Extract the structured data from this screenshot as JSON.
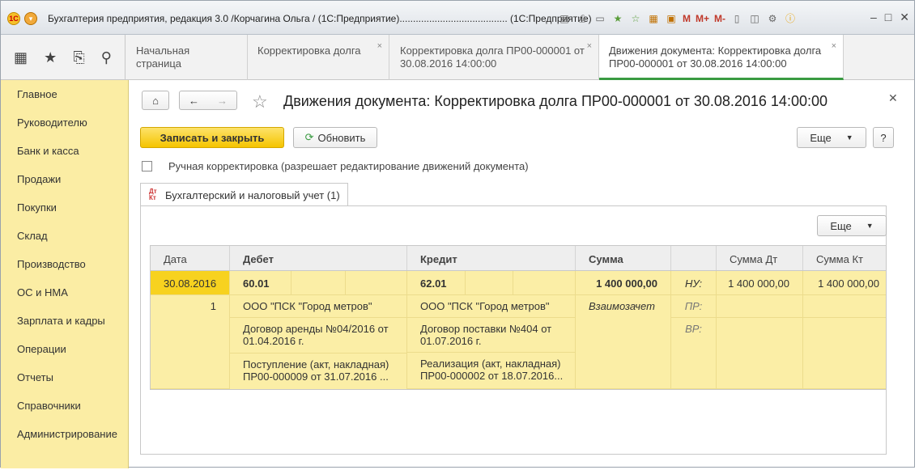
{
  "app": {
    "title": "Бухгалтерия предприятия, редакция 3.0 /Корчагина Ольга / (1С:Предприятие)........................................ (1С:Предприятие)",
    "toolbar_m": [
      "M",
      "M+",
      "M-"
    ]
  },
  "tabs": [
    {
      "label": "Начальная страница",
      "closable": false
    },
    {
      "label": "Корректировка долга",
      "closable": true
    },
    {
      "label": "Корректировка долга ПР00-000001 от 30.08.2016 14:00:00",
      "closable": true
    },
    {
      "label": "Движения документа: Корректировка долга ПР00-000001 от 30.08.2016 14:00:00",
      "closable": true,
      "active": true
    }
  ],
  "sidebar": {
    "items": [
      "Главное",
      "Руководителю",
      "Банк и касса",
      "Продажи",
      "Покупки",
      "Склад",
      "Производство",
      "ОС и НМА",
      "Зарплата и кадры",
      "Операции",
      "Отчеты",
      "Справочники",
      "Администрирование"
    ]
  },
  "form": {
    "title": "Движения документа: Корректировка долга ПР00-000001 от 30.08.2016 14:00:00",
    "save_close": "Записать и закрыть",
    "refresh": "Обновить",
    "more": "Еще",
    "help": "?",
    "manual_label": "Ручная корректировка (разрешает редактирование движений документа)",
    "subtab": "Бухгалтерский и налоговый учет (1)",
    "subtab_icon": "Дт\nКт",
    "panel_more": "Еще"
  },
  "grid": {
    "headers": [
      "Дата",
      "Дебет",
      "Кредит",
      "Сумма",
      "",
      "Сумма Дт",
      "Сумма Кт"
    ],
    "row": {
      "date": "30.08.2016",
      "num": "1",
      "debit_account": "60.01",
      "debit_sub1": "ООО \"ПСК \"Город метров\"",
      "debit_sub2": "Договор аренды №04/2016 от 01.04.2016 г.",
      "debit_sub3": "Поступление (акт, накладная) ПР00-000009 от 31.07.2016 ...",
      "credit_account": "62.01",
      "credit_sub1": "ООО \"ПСК \"Город метров\"",
      "credit_sub2": "Договор поставки №404 от 01.07.2016 г.",
      "credit_sub3": "Реализация (акт, накладная) ПР00-000002 от 18.07.2016...",
      "sum": "1 400 000,00",
      "content": "Взаимозачет",
      "nu": "НУ:",
      "pr": "ПР:",
      "vr": "ВР:",
      "sum_dt": "1 400 000,00",
      "sum_kt": "1 400 000,00"
    }
  }
}
